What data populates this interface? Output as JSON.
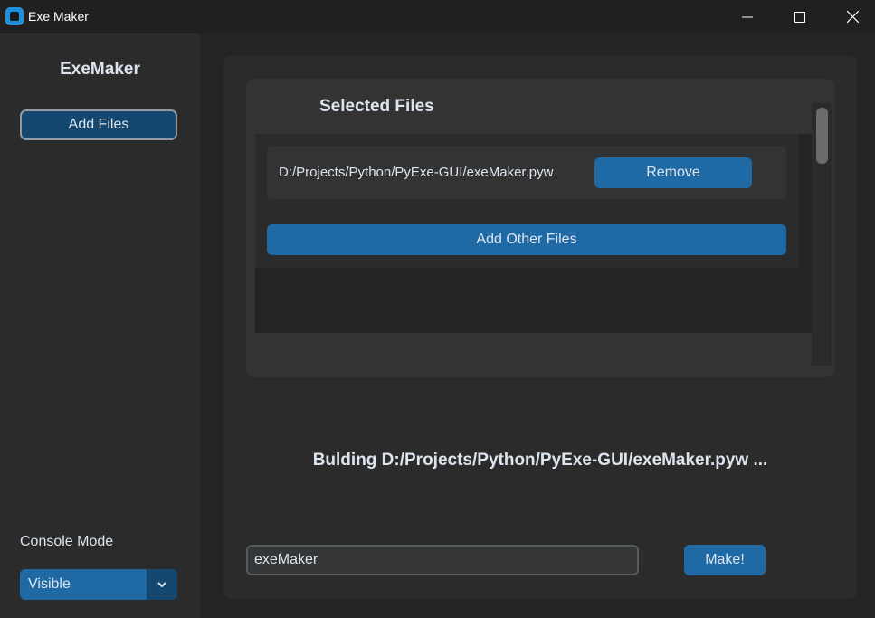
{
  "window": {
    "title": "Exe Maker"
  },
  "sidebar": {
    "logo": "ExeMaker",
    "add_files_label": "Add Files",
    "console_label": "Console Mode",
    "console_value": "Visible"
  },
  "files": {
    "title": "Selected Files",
    "items": [
      {
        "path": "D:/Projects/Python/PyExe-GUI/exeMaker.pyw",
        "remove_label": "Remove"
      }
    ],
    "add_other_label": "Add Other Files"
  },
  "status": "Bulding D:/Projects/Python/PyExe-GUI/exeMaker.pyw ...",
  "output": {
    "name_value": "exeMaker",
    "make_label": "Make!"
  },
  "colors": {
    "accent": "#1f6aa5",
    "accent_dark": "#144870",
    "background": "#242424",
    "panel": "#2b2b2b"
  },
  "icons": [
    "app-icon",
    "minimize-icon",
    "maximize-icon",
    "close-icon",
    "chevron-down-icon"
  ]
}
